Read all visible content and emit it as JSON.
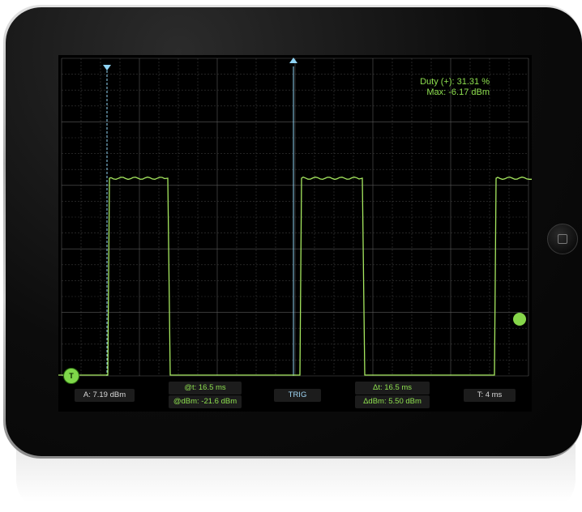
{
  "scope": {
    "readouts": {
      "duty": "Duty (+): 31.31 %",
      "max": "Max: -6.17 dBm"
    },
    "bottom_panel": {
      "amplitude": "A: 7.19 dBm",
      "cursor_time": "@t: 16.5 ms",
      "cursor_dbm": "@dBm: -21.6 dBm",
      "trig_button": "TRIG",
      "delta_t": "Δt: 16.5 ms",
      "delta_dbm": "ΔdBm: 5.50 dBm",
      "timebase": "T: 4 ms"
    },
    "trigger_marker_label": "T",
    "colors": {
      "trace": "#a6e85f",
      "grid": "#3a3a3a",
      "cursor": "#8fd3f4",
      "accent": "#8ee04f"
    }
  }
}
